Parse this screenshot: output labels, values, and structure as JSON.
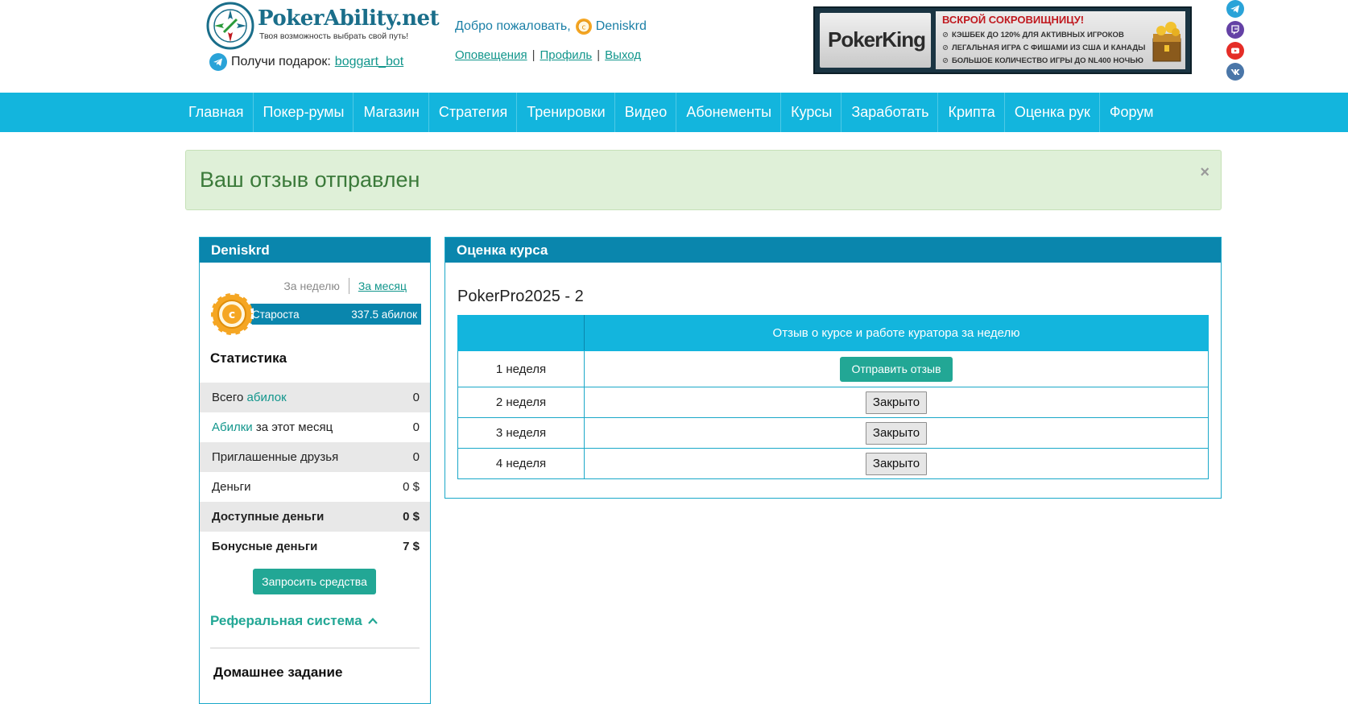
{
  "header": {
    "logo_name": "PokerAbility.net",
    "logo_tagline": "Твоя возможность выбрать свой путь!",
    "gift_text": "Получи подарок:",
    "gift_link": "boggart_bot",
    "welcome_text": "Добро пожаловать,",
    "username": "Deniskrd",
    "links": {
      "notifications": "Оповещения",
      "profile": "Профиль",
      "logout": "Выход",
      "separator": "|"
    },
    "banner": {
      "brand": "PokerKing",
      "title": "ВСКРОЙ СОКРОВИЩНИЦУ!",
      "lines": [
        "КЭШБЕК ДО 120% ДЛЯ АКТИВНЫХ ИГРОКОВ",
        "ЛЕГАЛЬНАЯ ИГРА С ФИШАМИ ИЗ США И КАНАДЫ",
        "БОЛЬШОЕ КОЛИЧЕСТВО ИГРЫ ДО NL400 НОЧЬЮ"
      ]
    },
    "socials": [
      {
        "icon": "telegram-icon",
        "color": "#2aa3d8"
      },
      {
        "icon": "twitch-icon",
        "color": "#6441a5"
      },
      {
        "icon": "youtube-icon",
        "color": "#e52d27"
      },
      {
        "icon": "vk-icon",
        "color": "#4a76a8"
      }
    ]
  },
  "nav": {
    "items": [
      "Главная",
      "Покер-румы",
      "Магазин",
      "Стратегия",
      "Тренировки",
      "Видео",
      "Абонементы",
      "Курсы",
      "Заработать",
      "Крипта",
      "Оценка рук",
      "Форум"
    ]
  },
  "alert": {
    "text": "Ваш отзыв отправлен",
    "close": "×"
  },
  "sidebar": {
    "title": "Deniskrd",
    "period_week": "За неделю",
    "period_month": "За месяц",
    "level_name": "Староста",
    "level_value": "337.5 абилок",
    "stats_title": "Статистика",
    "stats": {
      "total_prefix": "Всего",
      "total_link": "абилок",
      "total_value": "0",
      "month_link": "Абилки",
      "month_suffix": "за этот месяц",
      "month_value": "0",
      "friends_label": "Приглашенные друзья",
      "friends_value": "0",
      "money_label": "Деньги",
      "money_value": "0 $",
      "available_label": "Доступные деньги",
      "available_value": "0 $",
      "bonus_label": "Бонусные деньги",
      "bonus_value": "7 $"
    },
    "request_button": "Запросить средства",
    "referral": "Реферальная система",
    "homework": "Домашнее задание"
  },
  "main": {
    "title": "Оценка курса",
    "course_name": "PokerPro2025 - 2",
    "table_header": "Отзыв о курсе и работе куратора за неделю",
    "rows": [
      {
        "week": "1 неделя",
        "action": "Отправить отзыв"
      },
      {
        "week": "2 неделя",
        "action": "Закрыто"
      },
      {
        "week": "3 неделя",
        "action": "Закрыто"
      },
      {
        "week": "4 неделя",
        "action": "Закрыто"
      }
    ]
  },
  "colors": {
    "nav_bg": "#13b5dd",
    "panel_head": "#0a86ad",
    "accent_green": "#22a795",
    "alert_bg": "#dff0d8"
  }
}
